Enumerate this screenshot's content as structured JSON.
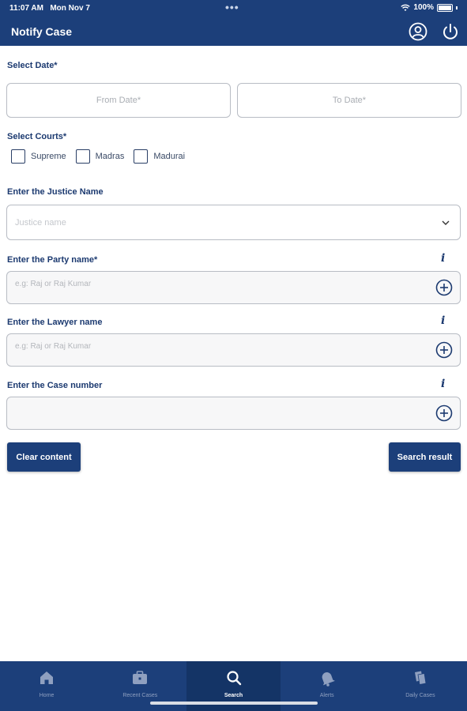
{
  "status_bar": {
    "time": "11:07 AM",
    "date": "Mon Nov 7",
    "dots": "•••",
    "battery": "100%"
  },
  "header": {
    "title": "Notify Case"
  },
  "date_section": {
    "label": "Select Date*",
    "from_placeholder": "From Date*",
    "to_placeholder": "To Date*"
  },
  "courts": {
    "label": "Select Courts*",
    "options": [
      "Supreme",
      "Madras",
      "Madurai"
    ]
  },
  "justice": {
    "label": "Enter the Justice Name",
    "placeholder": "Justice name"
  },
  "party": {
    "label": "Enter the Party name*",
    "placeholder": "e.g: Raj or Raj Kumar"
  },
  "lawyer": {
    "label": "Enter the Lawyer name",
    "placeholder": "e.g: Raj or Raj Kumar"
  },
  "case_number": {
    "label": "Enter the Case number",
    "placeholder": ""
  },
  "info_glyph": "i",
  "buttons": {
    "clear": "Clear content",
    "search": "Search result"
  },
  "tabs": [
    {
      "label": "Home",
      "icon": "home-icon"
    },
    {
      "label": "Recent Cases",
      "icon": "briefcase-icon"
    },
    {
      "label": "Search",
      "icon": "search-icon",
      "active": true
    },
    {
      "label": "Alerts",
      "icon": "bell-icon"
    },
    {
      "label": "Daily Cases",
      "icon": "documents-icon"
    }
  ],
  "colors": {
    "primary": "#1c3f7a",
    "active_tab": "#143466",
    "label_text": "#1c3a70",
    "border": "#b8bcc4"
  }
}
